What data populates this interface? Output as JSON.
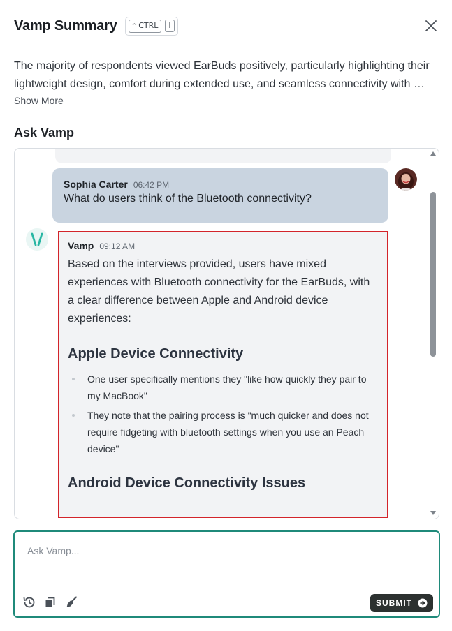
{
  "header": {
    "title": "Vamp Summary",
    "shortcut_mod": "CTRL",
    "shortcut_key": "I"
  },
  "summary": {
    "text": "The majority of respondents viewed EarBuds positively, particularly highlighting their lightweight design, comfort during extended use, and seamless connectivity with …",
    "show_more": "Show More"
  },
  "ask": {
    "title": "Ask Vamp"
  },
  "chat": {
    "user_message": {
      "sender": "Sophia Carter",
      "time": "06:42 PM",
      "text": "What do users think of the Bluetooth connectivity?"
    },
    "vamp_message": {
      "sender": "Vamp",
      "time": "09:12 AM",
      "intro": "Based on the interviews provided, users have mixed experiences with Bluetooth connectivity for the EarBuds, with a clear difference between Apple and Android device experiences:",
      "heading1": "Apple Device Connectivity",
      "bullets": [
        "One user specifically mentions they \"like how quickly they pair to my MacBook\"",
        "They note that the pairing process is \"much quicker and does not require fidgeting with bluetooth settings when you use an Peach device\""
      ],
      "heading2": "Android Device Connectivity Issues"
    }
  },
  "composer": {
    "placeholder": "Ask Vamp...",
    "submit_label": "SUBMIT"
  },
  "colors": {
    "accent": "#1f8a7a",
    "highlight_border": "#d3242a",
    "user_bubble": "#c9d4e0",
    "vamp_bubble": "#f2f3f5",
    "submit_bg": "#2c3130"
  },
  "icons": {
    "close": "close-icon",
    "history": "history-icon",
    "copy": "copy-icon",
    "clear": "broom-icon",
    "submit": "arrow-right-circle-icon"
  }
}
